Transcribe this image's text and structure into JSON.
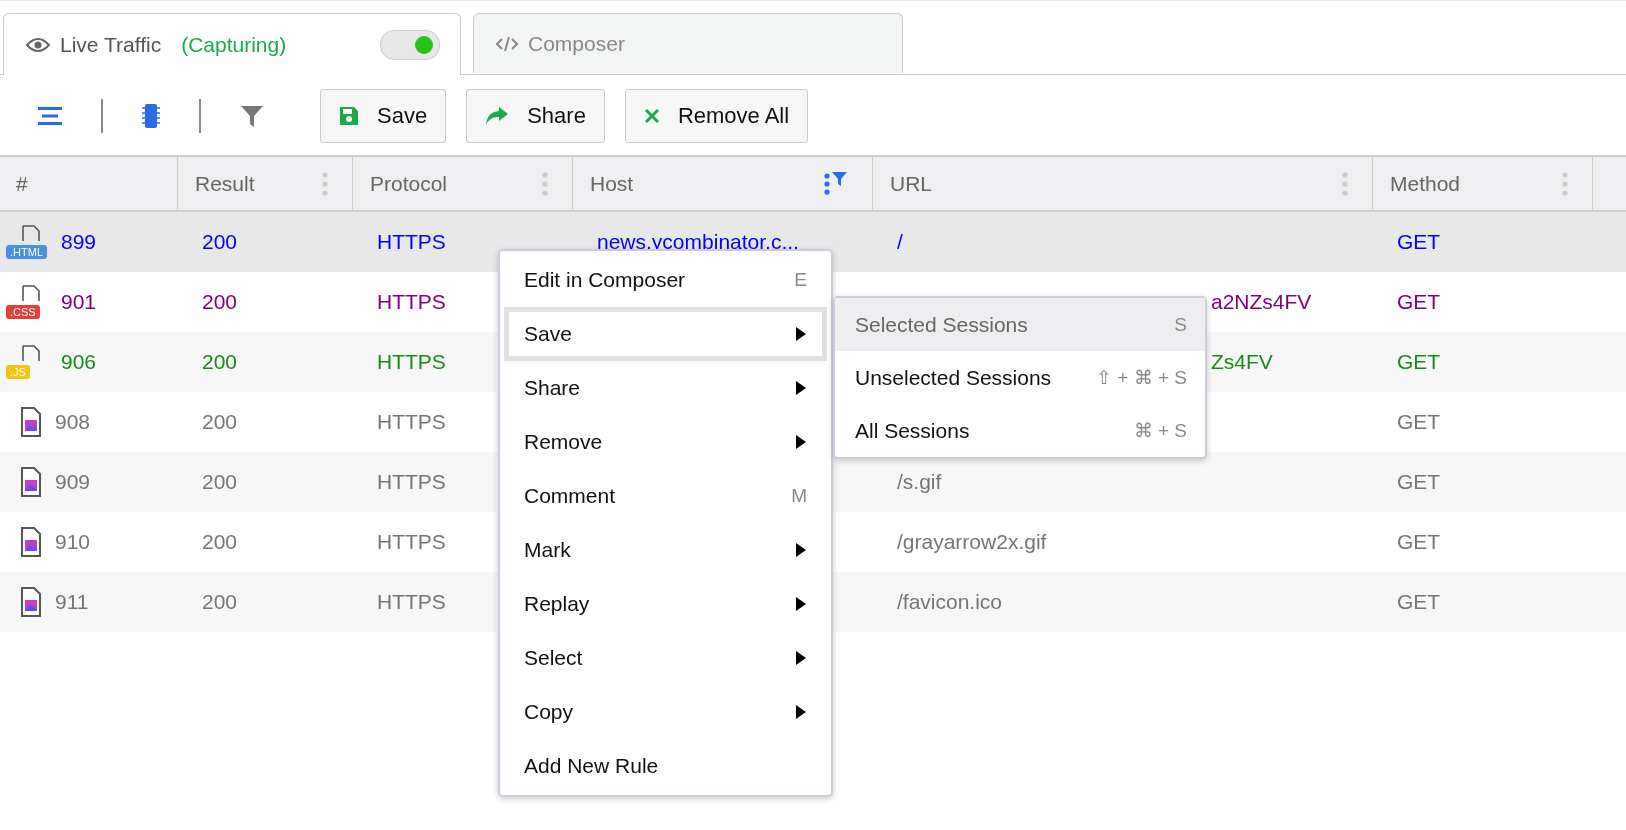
{
  "tabs": [
    {
      "kind": "live",
      "label": "Live Traffic",
      "status": "(Capturing)",
      "capturing": true,
      "selected": true
    },
    {
      "kind": "composer",
      "label": "Composer",
      "selected": false
    }
  ],
  "toolbar": {
    "buttons": [
      {
        "kind": "save",
        "label": "Save"
      },
      {
        "kind": "share",
        "label": "Share"
      },
      {
        "kind": "remove",
        "label": "Remove All"
      }
    ]
  },
  "table": {
    "columns": [
      {
        "label": "#",
        "kind": "plain"
      },
      {
        "label": "Result",
        "kind": "menu"
      },
      {
        "label": "Protocol",
        "kind": "menu"
      },
      {
        "label": "Host",
        "kind": "filtered"
      },
      {
        "label": "URL",
        "kind": "menu"
      },
      {
        "label": "Method",
        "kind": "menu"
      }
    ],
    "rows": [
      {
        "kind": "html",
        "badge": ".HTML",
        "id": "899",
        "result": "200",
        "protocol": "HTTPS",
        "host": "news.ycombinator.c...",
        "url": "/",
        "method": "GET",
        "color": "#0000ff",
        "selected": true
      },
      {
        "kind": "css",
        "badge": ".CSS",
        "id": "901",
        "result": "200",
        "protocol": "HTTPS",
        "url": "a2NZs4FV",
        "url_covered": true,
        "method": "GET",
        "color": "#800080",
        "selected": false
      },
      {
        "kind": "js",
        "badge": ".JS",
        "id": "906",
        "result": "200",
        "protocol": "HTTPS",
        "url": "Zs4FV",
        "url_covered": true,
        "method": "GET",
        "color": "#1a8a1a",
        "selected": false
      },
      {
        "kind": "image",
        "id": "908",
        "result": "200",
        "protocol": "HTTPS",
        "method": "GET",
        "color": "#757575",
        "selected": false
      },
      {
        "kind": "image",
        "id": "909",
        "result": "200",
        "protocol": "HTTPS",
        "url": "/s.gif",
        "method": "GET",
        "color": "#757575",
        "selected": false
      },
      {
        "kind": "image",
        "id": "910",
        "result": "200",
        "protocol": "HTTPS",
        "url": "/grayarrow2x.gif",
        "method": "GET",
        "color": "#757575",
        "selected": false
      },
      {
        "kind": "image",
        "id": "911",
        "result": "200",
        "protocol": "HTTPS",
        "url": "/favicon.ico",
        "method": "GET",
        "color": "#757575",
        "selected": false
      }
    ]
  },
  "context_menu": {
    "items": [
      {
        "label": "Edit in Composer",
        "shortcut": "E",
        "submenu": false,
        "selected": false
      },
      {
        "label": "Save",
        "submenu": true,
        "selected": true
      },
      {
        "label": "Share",
        "submenu": true,
        "selected": false
      },
      {
        "label": "Remove",
        "submenu": true,
        "selected": false
      },
      {
        "label": "Comment",
        "shortcut": "M",
        "submenu": false,
        "selected": false
      },
      {
        "label": "Mark",
        "submenu": true,
        "selected": false
      },
      {
        "label": "Replay",
        "submenu": true,
        "selected": false
      },
      {
        "label": "Select",
        "submenu": true,
        "selected": false
      },
      {
        "label": "Copy",
        "submenu": true,
        "selected": false
      },
      {
        "label": "Add New Rule",
        "submenu": false,
        "selected": false
      }
    ],
    "submenu": [
      {
        "label": "Selected Sessions",
        "shortcut": "S",
        "selected": true
      },
      {
        "label": "Unselected Sessions",
        "shortcut": "⇧ + ⌘ + S",
        "selected": false
      },
      {
        "label": "All Sessions",
        "shortcut": "⌘ + S",
        "selected": false
      }
    ]
  }
}
